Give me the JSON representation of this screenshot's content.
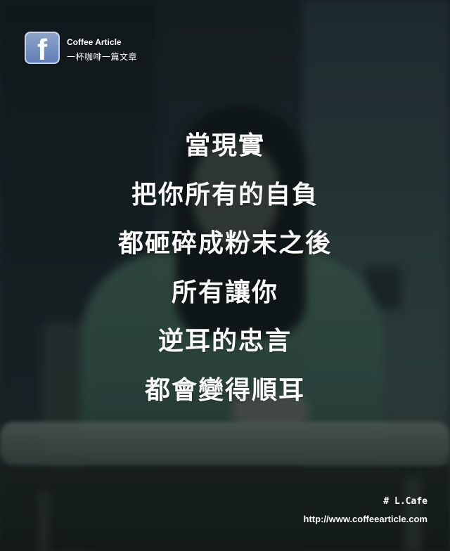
{
  "header": {
    "logo_letter": "f",
    "logo_icon": "facebook-icon",
    "site_name": "Coffee Article",
    "tagline": "一杯咖啡一篇文章"
  },
  "quote": {
    "lines": [
      "當現實",
      "把你所有的自負",
      "都砸碎成粉末之後",
      "所有讓你",
      "逆耳的忠言",
      "都會變得順耳"
    ]
  },
  "footer": {
    "hashtag": "# L.Cafe",
    "url": "http://www.coffeearticle.com"
  },
  "colors": {
    "text": "#ffffff",
    "logo_blue": "#5f7bb4",
    "background": "#1d282c"
  }
}
